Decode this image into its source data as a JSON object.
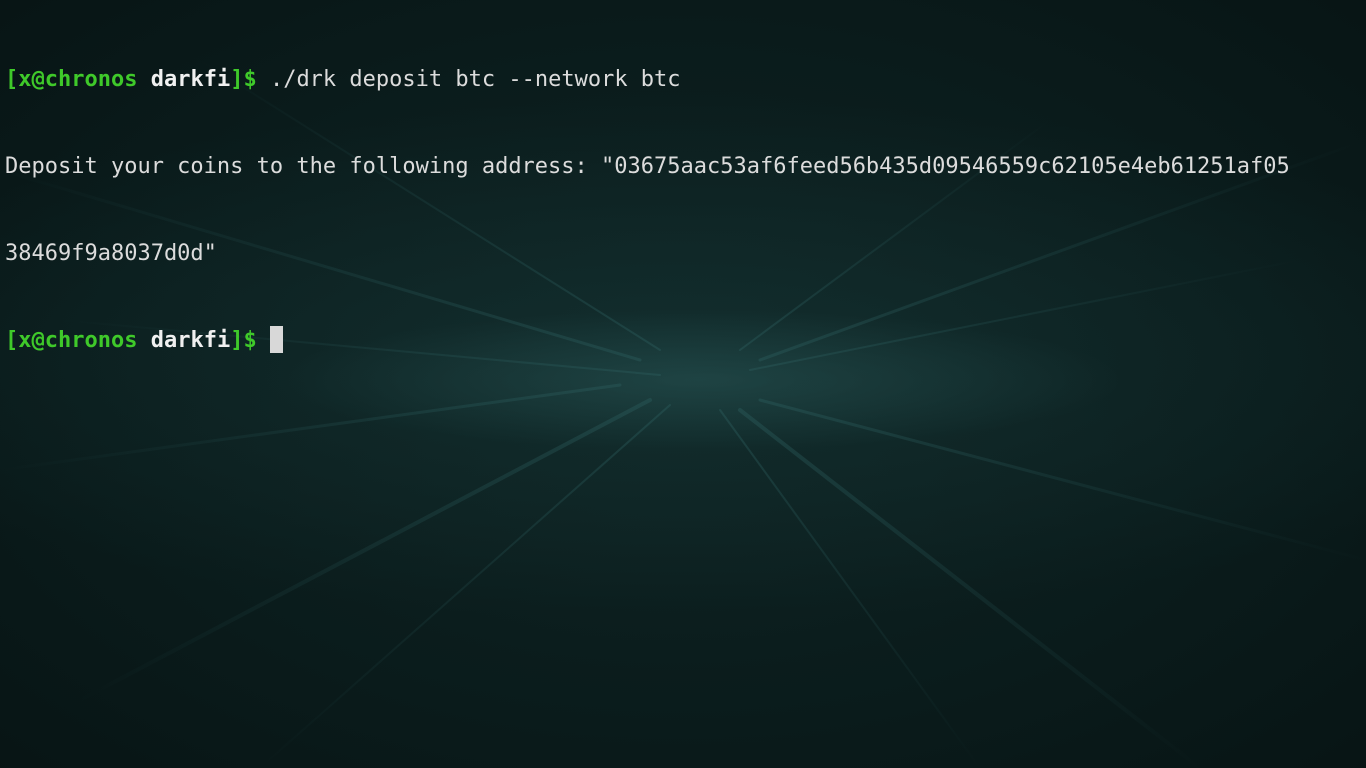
{
  "prompt": {
    "open_bracket": "[",
    "user_host": "x@chronos",
    "space": " ",
    "directory": "darkfi",
    "close": "]$"
  },
  "lines": {
    "command": " ./drk deposit btc --network btc",
    "output_1": "Deposit your coins to the following address: \"03675aac53af6feed56b435d09546559c62105e4eb61251af05",
    "output_2": "38469f9a8037d0d\""
  },
  "colors": {
    "prompt_green": "#3fc92a",
    "text": "#dcdcdc",
    "background": "#071313"
  }
}
